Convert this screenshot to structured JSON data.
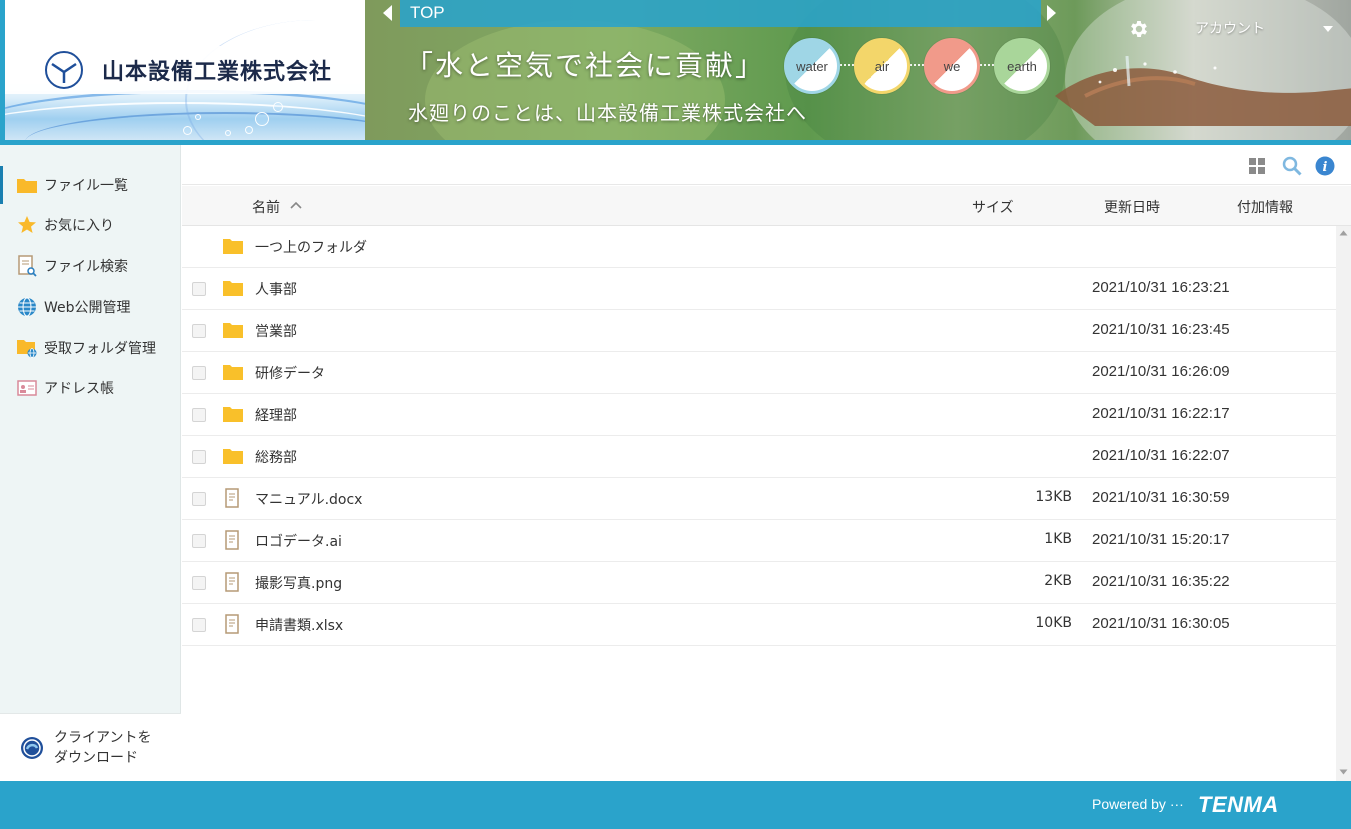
{
  "header": {
    "company_name": "山本設備工業株式会社",
    "breadcrumb": "TOP",
    "tagline_main": "「水と空気で社会に貢献」",
    "tagline_sub": "水廻りのことは、山本設備工業株式会社へ",
    "eco_circles": [
      {
        "label": "water",
        "color": "#9fd6e6"
      },
      {
        "label": "air",
        "color": "#f3d66a"
      },
      {
        "label": "we",
        "color": "#f19a8a"
      },
      {
        "label": "earth",
        "color": "#a9d69a"
      }
    ],
    "account_label": "アカウント"
  },
  "sidebar": {
    "items": [
      {
        "label": "ファイル一覧",
        "icon": "folder-icon",
        "active": true
      },
      {
        "label": "お気に入り",
        "icon": "star-icon",
        "active": false
      },
      {
        "label": "ファイル検索",
        "icon": "file-search-icon",
        "active": false
      },
      {
        "label": "Web公開管理",
        "icon": "globe-icon",
        "active": false
      },
      {
        "label": "受取フォルダ管理",
        "icon": "receive-folder-icon",
        "active": false
      },
      {
        "label": "アドレス帳",
        "icon": "address-book-icon",
        "active": false
      }
    ],
    "download_line1": "クライアントを",
    "download_line2": "ダウンロード"
  },
  "list": {
    "columns": {
      "name": "名前",
      "size": "サイズ",
      "updated": "更新日時",
      "extra": "付加情報"
    },
    "parent_folder": "一つ上のフォルダ",
    "rows": [
      {
        "name": "人事部",
        "type": "folder",
        "size": "",
        "updated": "2021/10/31 16:23:21"
      },
      {
        "name": "営業部",
        "type": "folder",
        "size": "",
        "updated": "2021/10/31 16:23:45"
      },
      {
        "name": "研修データ",
        "type": "folder",
        "size": "",
        "updated": "2021/10/31 16:26:09"
      },
      {
        "name": "経理部",
        "type": "folder",
        "size": "",
        "updated": "2021/10/31 16:22:17"
      },
      {
        "name": "総務部",
        "type": "folder",
        "size": "",
        "updated": "2021/10/31 16:22:07"
      },
      {
        "name": "マニュアル.docx",
        "type": "file",
        "size": "13KB",
        "updated": "2021/10/31 16:30:59"
      },
      {
        "name": "ロゴデータ.ai",
        "type": "file",
        "size": "1KB",
        "updated": "2021/10/31 15:20:17"
      },
      {
        "name": "撮影写真.png",
        "type": "file",
        "size": "2KB",
        "updated": "2021/10/31 16:35:22"
      },
      {
        "name": "申請書類.xlsx",
        "type": "file",
        "size": "10KB",
        "updated": "2021/10/31 16:30:05"
      }
    ]
  },
  "footer": {
    "powered_by": "Powered by ···",
    "brand": "TENMA"
  },
  "colors": {
    "accent": "#2aa3cb",
    "folder": "#f9c02a",
    "file": "#b69a76"
  }
}
